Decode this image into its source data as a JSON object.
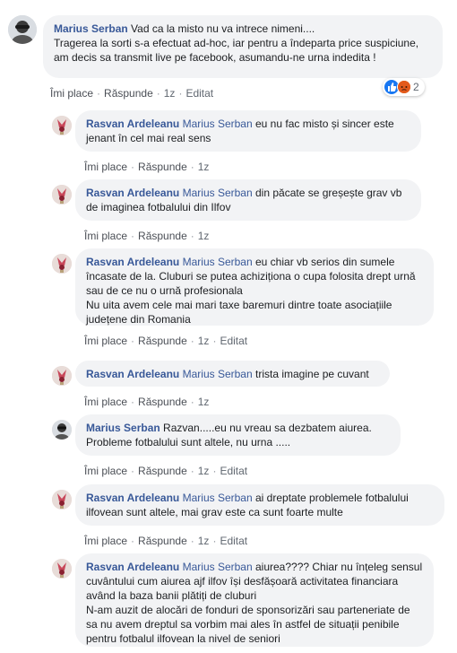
{
  "actions": {
    "like": "Îmi place",
    "reply": "Răspunde",
    "edited": "Editat",
    "sep": "·"
  },
  "main_comment": {
    "author": "Marius Serban",
    "text": "Vad ca la misto nu va intrece nimeni....\nTragerea la sorti s-a efectuat ad-hoc, iar pentru a îndeparta price suspiciune, am decis sa transmit live pe facebook, asumandu-ne urna indedita !",
    "time": "1z",
    "reaction_count": "2"
  },
  "replies": [
    {
      "author": "Rasvan Ardeleanu",
      "mention": "Marius Serban",
      "text": "eu nu fac misto și sincer este jenant în cel mai real sens",
      "time": "1z",
      "edited": false
    },
    {
      "author": "Rasvan Ardeleanu",
      "mention": "Marius Serban",
      "text": "din păcate se greșește grav vb de imaginea fotbalului din Ilfov",
      "time": "1z",
      "edited": false
    },
    {
      "author": "Rasvan Ardeleanu",
      "mention": "Marius Serban",
      "text": "eu chiar vb serios din sumele încasate de la. Cluburi se putea achiziționa o cupa folosita drept urnă sau de ce nu o urnă profesionala\nNu uita avem cele mai mari taxe baremuri dintre toate asociațiile județene din Romania",
      "time": "1z",
      "edited": true
    },
    {
      "author": "Rasvan Ardeleanu",
      "mention": "Marius Serban",
      "text": "trista imagine pe cuvant",
      "time": "1z",
      "edited": false
    },
    {
      "author": "Marius Serban",
      "mention": "",
      "text": "Razvan.....eu nu vreau sa dezbatem aiurea.\nProbleme fotbalului sunt altele, nu urna .....",
      "time": "1z",
      "edited": true
    },
    {
      "author": "Rasvan Ardeleanu",
      "mention": "Marius Serban",
      "text": "ai dreptate problemele fotbalului ilfovean sunt altele, mai grav este ca sunt foarte multe",
      "time": "1z",
      "edited": true
    },
    {
      "author": "Rasvan Ardeleanu",
      "mention": "Marius Serban",
      "text": "aiurea???? Chiar nu înțeleg sensul cuvântului cum aiurea ajf ilfov își desfășoară activitatea financiara având la baza banii plătiți de cluburi\nN-am auzit de alocări de fonduri de sponsorizări sau parteneriate de sa nu avem dreptul sa vorbim mai ales în astfel de situații penibile pentru fotbalul ilfovean la nivel de seniori",
      "time": "",
      "edited": false
    }
  ]
}
